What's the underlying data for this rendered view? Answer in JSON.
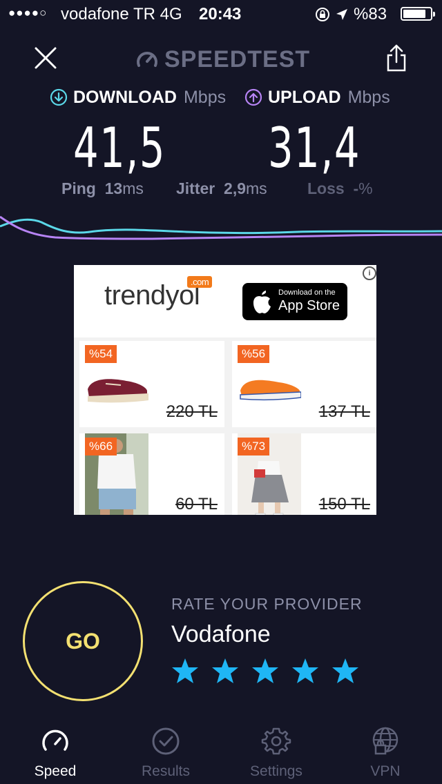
{
  "status_bar": {
    "signal": "●●●●○",
    "carrier": "vodafone TR  4G",
    "time": "20:43",
    "battery": "%83"
  },
  "header": {
    "logo_text": "SPEEDTEST",
    "icons": [
      "close-icon",
      "speedometer-icon",
      "share-icon"
    ]
  },
  "download": {
    "label": "DOWNLOAD",
    "unit": "Mbps",
    "value": "41,5",
    "color": "#5bd8e8"
  },
  "upload": {
    "label": "UPLOAD",
    "unit": "Mbps",
    "value": "31,4",
    "color": "#b784f5"
  },
  "stats": {
    "ping_label": "Ping",
    "ping_value": "13",
    "ping_unit": "ms",
    "jitter_label": "Jitter",
    "jitter_value": "2,9",
    "jitter_unit": "ms",
    "loss_label": "Loss",
    "loss_value": "-",
    "loss_unit": "%"
  },
  "ad": {
    "brand": "trendyol",
    "brand_badge": ".com",
    "appstore_small": "Download on the",
    "appstore_large": "App Store",
    "products": [
      {
        "badge": "%54",
        "price": "220 TL",
        "item": "burgundy sneaker"
      },
      {
        "badge": "%56",
        "price": "137 TL",
        "item": "orange sneaker"
      },
      {
        "badge": "%66",
        "price": "60 TL",
        "item": "white tshirt"
      },
      {
        "badge": "%73",
        "price": "150 TL",
        "item": "grey skirt outfit"
      }
    ]
  },
  "go_button": {
    "label": "GO",
    "color": "#f3e071"
  },
  "rate": {
    "title": "RATE YOUR PROVIDER",
    "provider": "Vodafone",
    "stars": 5,
    "star_color": "#1fb6f5"
  },
  "tabs": [
    {
      "label": "Speed",
      "icon": "speedometer-icon",
      "active": true
    },
    {
      "label": "Results",
      "icon": "check-circle-icon",
      "active": false
    },
    {
      "label": "Settings",
      "icon": "gear-icon",
      "active": false
    },
    {
      "label": "VPN",
      "icon": "globe-lock-icon",
      "active": false
    }
  ]
}
